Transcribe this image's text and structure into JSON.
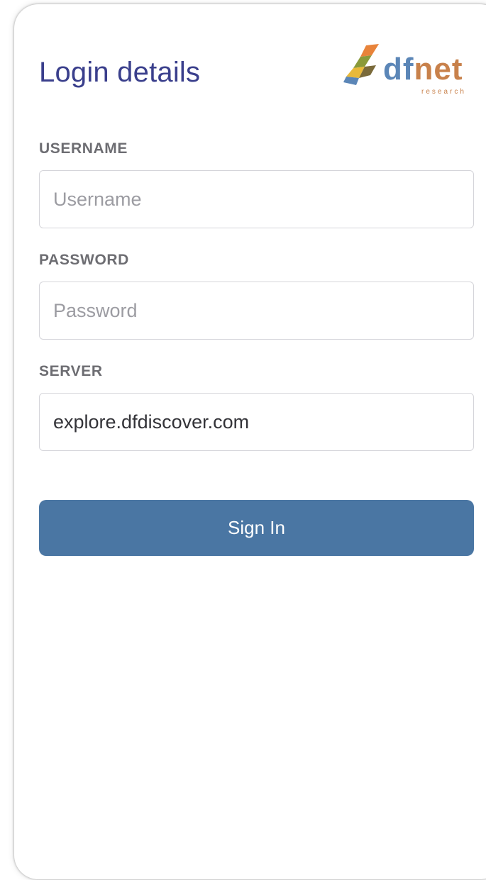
{
  "header": {
    "title": "Login details",
    "logo": {
      "text_df": "df",
      "text_net": "net",
      "subtext": "research",
      "colors": {
        "df": "#5b86b7",
        "net": "#c8814b"
      }
    }
  },
  "form": {
    "username": {
      "label": "USERNAME",
      "placeholder": "Username",
      "value": ""
    },
    "password": {
      "label": "PASSWORD",
      "placeholder": "Password",
      "value": ""
    },
    "server": {
      "label": "SERVER",
      "placeholder": "",
      "value": "explore.dfdiscover.com"
    },
    "submit_label": "Sign In"
  },
  "colors": {
    "title": "#3a3f8c",
    "button": "#4a76a3",
    "label": "#6d6d72"
  }
}
